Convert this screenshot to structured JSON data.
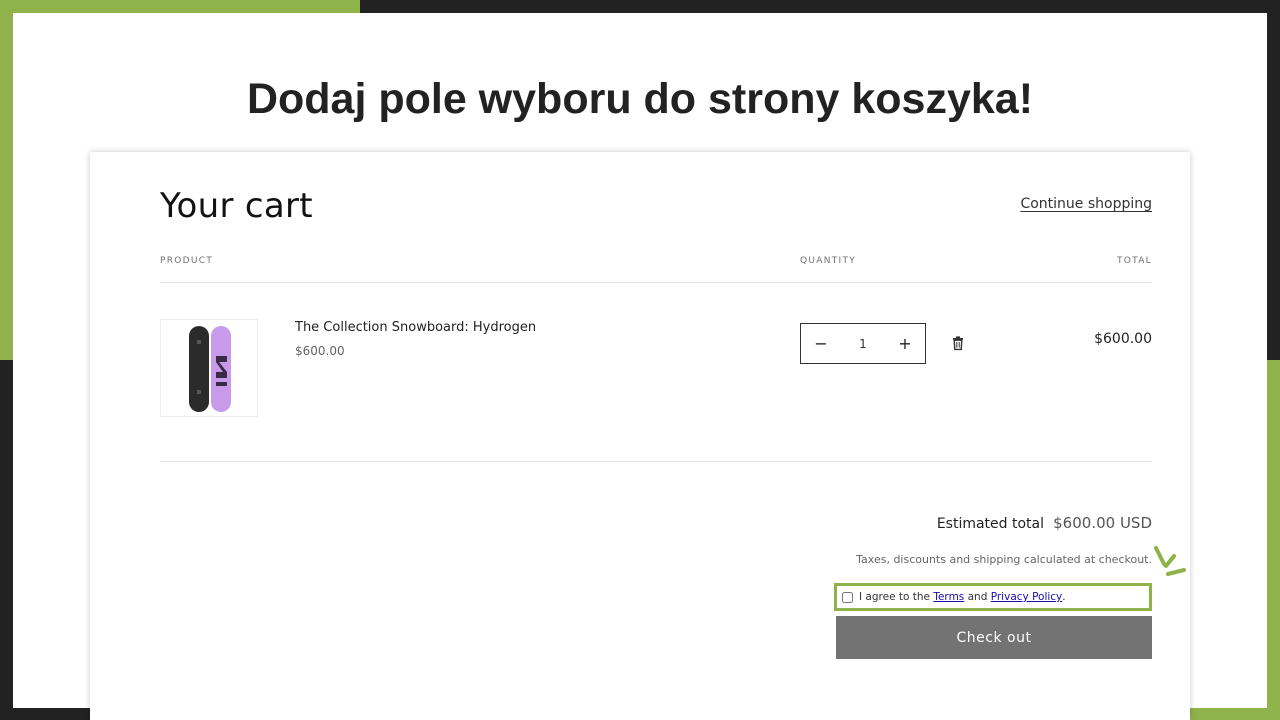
{
  "slide": {
    "headline": "Dodaj pole wyboru do strony koszyka!"
  },
  "colors": {
    "accent_green": "#8fb34a",
    "dark_background": "#222222",
    "checkout_button": "#737373",
    "link_blue": "#1a0dab"
  },
  "cart": {
    "title": "Your cart",
    "continue_shopping": "Continue shopping",
    "columns": {
      "product": "PRODUCT",
      "quantity": "QUANTITY",
      "total": "TOTAL"
    },
    "items": [
      {
        "name": "The Collection Snowboard: Hydrogen",
        "price": "$600.00",
        "quantity": "1",
        "line_total": "$600.00",
        "decrease_icon": "minus-icon",
        "increase_icon": "plus-icon",
        "remove_icon": "trash-icon"
      }
    ],
    "estimated_total_label": "Estimated total",
    "estimated_total_value": "$600.00 USD",
    "tax_note": "Taxes, discounts and shipping calculated at checkout.",
    "agreement": {
      "prefix": "I agree to the",
      "terms_link": "Terms",
      "conjunction": "and",
      "privacy_link": "Privacy Policy",
      "suffix": ".",
      "checked": false
    },
    "checkout_label": "Check out"
  }
}
